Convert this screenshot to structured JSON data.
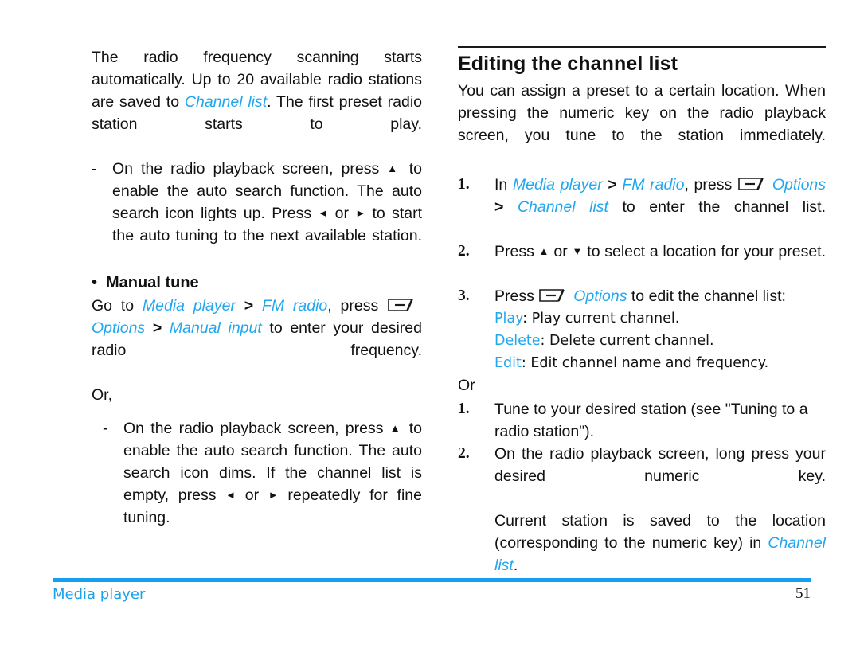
{
  "page": {
    "number": "51",
    "footer_section": "Media player",
    "accent_color": "#22a7ee",
    "footer_rule_color": "#159ff0",
    "text_color": "#111111"
  },
  "icons": {
    "softkey_options": "left-soft-key-icon",
    "arrow_up": "▲",
    "arrow_down": "▼",
    "arrow_left": "◄",
    "arrow_right": "►",
    "bullet": "•",
    "dash": "-"
  },
  "left_column": {
    "intro": {
      "t1": "The radio frequency scanning starts automatically. Up to 20 available radio stations are saved to ",
      "link1": "Channel list",
      "t2": ". The first preset radio station starts to play."
    },
    "dash_item_1": {
      "marker": "-",
      "t1": "On the radio playback screen, press ",
      "arrow1": "▲",
      "t2": " to enable the auto search function. The auto search icon lights up. Press ",
      "arrow2": "◄",
      "t3": " or ",
      "arrow3": "►",
      "t4": " to start the auto tuning to the next available station."
    },
    "manual_tune": {
      "bullet": "•",
      "heading": "Manual tune",
      "t1": "Go to ",
      "link1": "Media player",
      "gt1": " > ",
      "link2": "FM radio",
      "t2": ", press ",
      "softkey": "left-soft-key-icon",
      "link3": "Options",
      "gt2": " > ",
      "link4": "Manual input",
      "t3": " to enter your desired radio frequency."
    },
    "or_text": "Or,",
    "dash_item_2": {
      "marker": "-",
      "t1": "On the radio playback screen, press ",
      "arrow1": "▲",
      "t2": " to enable the auto search function. The auto search icon dims. If the channel list is empty, press ",
      "arrow2": "◄",
      "t3": " or ",
      "arrow3": "►",
      "t4": " repeatedly for fine tuning."
    }
  },
  "right_column": {
    "heading": "Editing the channel list",
    "intro": "You can assign a preset to a certain location. When pressing the numeric key on the radio playback screen, you tune to the station immediately.",
    "steps_a": [
      {
        "num": "1.",
        "t1": "In ",
        "link1": "Media player",
        "gt1": " > ",
        "link2": "FM radio",
        "t2": ", press ",
        "softkey": "left-soft-key-icon",
        "link3": "Options",
        "gt2": " > ",
        "link4": "Channel list",
        "t3": " to enter the channel list."
      },
      {
        "num": "2.",
        "t1": "Press ",
        "arrow1": "▲",
        "t2": " or ",
        "arrow2": "▼",
        "t3": " to select a location for your preset."
      },
      {
        "num": "3.",
        "t1": "Press ",
        "softkey": "left-soft-key-icon",
        "link1": "Options",
        "t2": " to edit the channel list:"
      }
    ],
    "options": [
      {
        "label": "Play",
        "desc": ": Play current channel."
      },
      {
        "label": "Delete",
        "desc": ": Delete current channel."
      },
      {
        "label": "Edit",
        "desc": ": Edit channel name and frequency."
      }
    ],
    "or_text": "Or",
    "steps_b": [
      {
        "num": "1.",
        "text": "Tune to your desired station (see \"Tuning to a radio station\")."
      },
      {
        "num": "2.",
        "text": "On the radio playback screen, long press your desired numeric key."
      }
    ],
    "closing": {
      "t1": "Current station is saved to the location (corresponding to the numeric key) in ",
      "link1": "Channel list",
      "t2": "."
    }
  }
}
